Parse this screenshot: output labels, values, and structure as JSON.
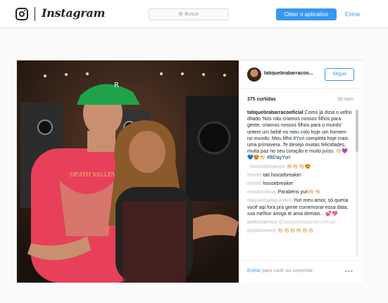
{
  "header": {
    "wordmark": "Instagram",
    "search_placeholder": "Busca",
    "get_app_label": "Obter o aplicativo",
    "login_label": "Entrar"
  },
  "post": {
    "username": "tatiquebrabarracoo...",
    "follow_label": "Seguir",
    "likes": "375 curtidas",
    "age": "38 sem",
    "caption_user": "tatiquebrabarracooficial",
    "caption_text_1": "Como já dizia o velho ditado 'Nós não criamos nossos filhos para gente, criamos nossos filhos para o mundo' ontem um bebê no meu colo hoje um homem no mundo. Meu filho ",
    "caption_hashtag_1": "#Yuri",
    "caption_text_2": " completa hoje mais uma primavera. Te desejo muitas felicidades, muita paz no seu coração e muito juízo. 👏🏻💜💙😍👏🏻 ",
    "caption_hashtag_2": "#BDayYuri",
    "comments": [
      {
        "user": "_housebreakers",
        "text": "👏🏻👏🏻👏🏻😍",
        "blurred": true
      },
      {
        "user": "lrbs00",
        "text": "tati housebreaker",
        "blurred": true
      },
      {
        "user": "lrbs00",
        "text": "housebreaker",
        "blurred": true
      },
      {
        "user": "romanoficial",
        "text": "Parabéns yuri👏🏻👏🏻",
        "blurred": true
      },
      {
        "user": "mayuinhafagundes",
        "text": "Yuri meu amor, só queria você aqi fora pra gente comemorar essa data, sua melhor amiga te ama demais... 💕💖",
        "blurred": true
      },
      {
        "user": "pedrocarrico",
        "text": "@tatiquebrabarracooficial",
        "blurred": true
      },
      {
        "user": "pviotormont",
        "text": "👏🏻👏🏻👏🏻👏🏻👏🏻👏🏻",
        "blurred": true
      }
    ],
    "footer_login": "Entrar",
    "footer_text": " para curtir ou comentar.",
    "more_label": "•••"
  },
  "photo": {
    "cap_text": "R",
    "shirt_text": "DEATH VALLEY"
  },
  "colors": {
    "accent": "#3897f0",
    "hashtag": "#003569",
    "cap": "#1fa34a",
    "shirt": "#e8405a"
  }
}
